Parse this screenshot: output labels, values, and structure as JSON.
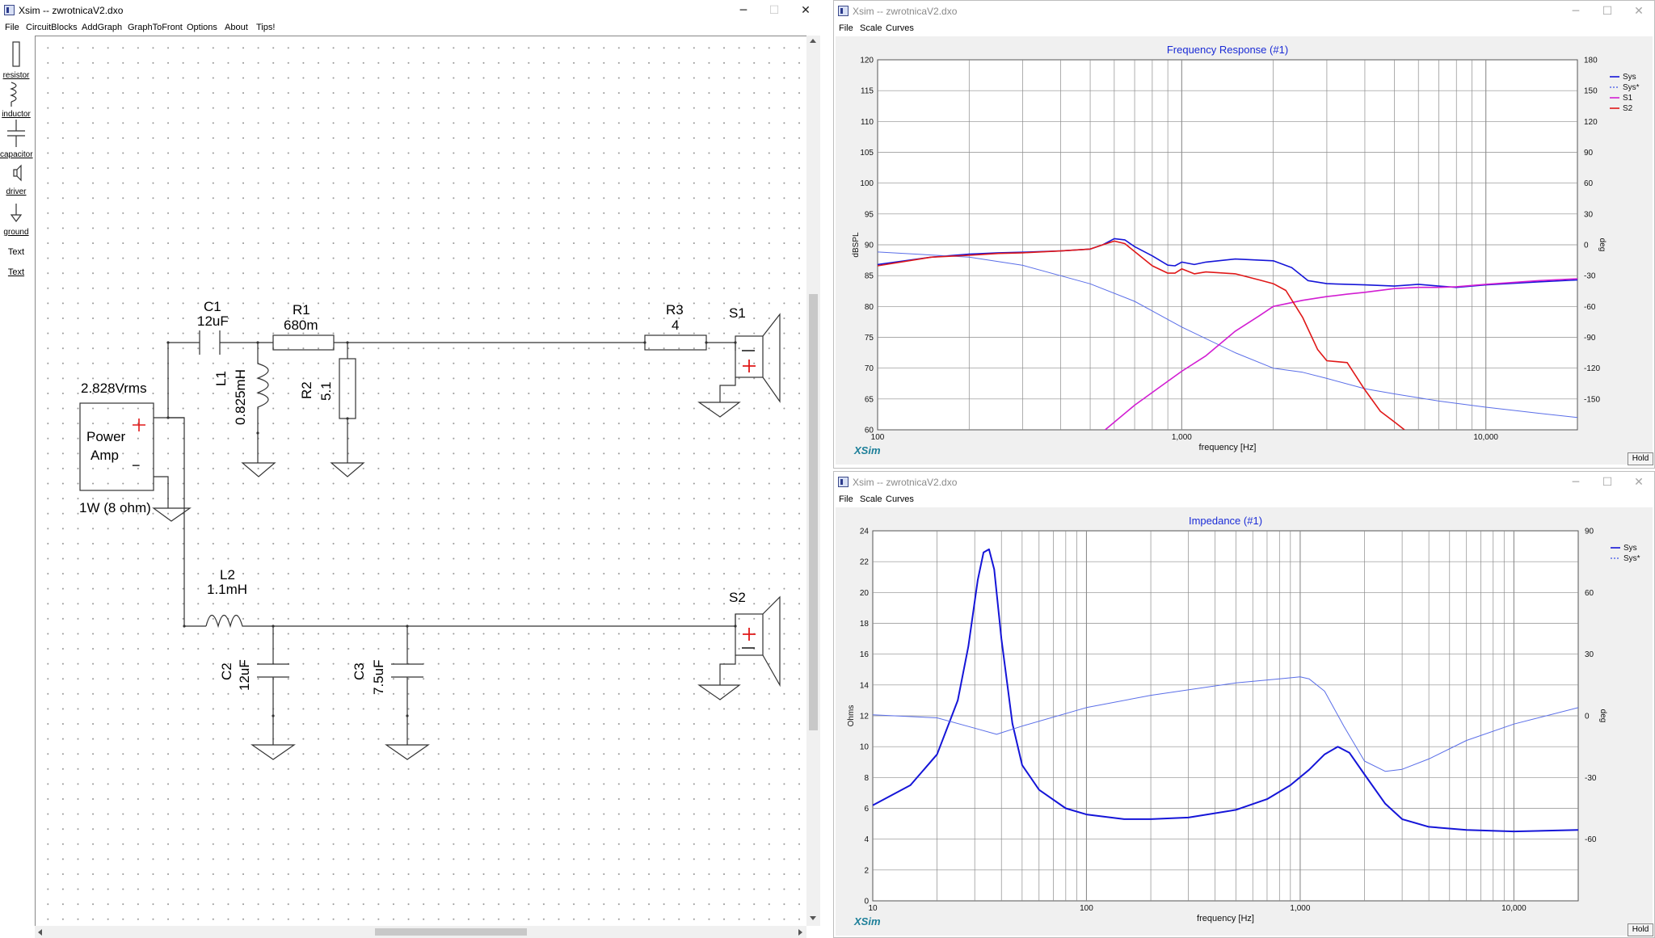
{
  "xsim_window": {
    "title": "Xsim -- zwrotnicaV2.dxo",
    "menu": [
      "File",
      "CircuitBlocks",
      "AddGraph",
      "GraphToFront",
      "Options",
      "About",
      "Tips!"
    ],
    "controls": {
      "minimize": "─",
      "maximize": "☐",
      "close": "✕"
    }
  },
  "toolbox": [
    {
      "icon": "resistor-icon",
      "label": "resistor"
    },
    {
      "icon": "inductor-icon",
      "label": "inductor"
    },
    {
      "icon": "capacitor-icon",
      "label": "capacitor"
    },
    {
      "icon": "driver-icon",
      "label": "driver"
    },
    {
      "icon": "ground-icon",
      "label": "ground"
    },
    {
      "icon": "",
      "label": "Text"
    },
    {
      "icon": "",
      "label": "Text"
    }
  ],
  "circuit": {
    "c1": {
      "name": "C1",
      "value": "12uF"
    },
    "r1": {
      "name": "R1",
      "value": "680m"
    },
    "r3": {
      "name": "R3",
      "value": "4"
    },
    "s1": {
      "name": "S1"
    },
    "l1": {
      "name": "L1",
      "value": "0.825mH"
    },
    "r2": {
      "name": "R2",
      "value": "5.1"
    },
    "source": {
      "voltage": "2.828Vrms",
      "line1": "Power",
      "line2": "Amp",
      "rating": "1W (8 ohm)",
      "plus": "+",
      "minus": "−"
    },
    "l2": {
      "name": "L2",
      "value": "1.1mH"
    },
    "s2": {
      "name": "S2"
    },
    "c2": {
      "name": "C2",
      "value": "12uF"
    },
    "c3": {
      "name": "C3",
      "value": "7.5uF"
    }
  },
  "freq_window": {
    "title": "Xsim -- zwrotnicaV2.dxo",
    "menu": [
      "File",
      "Scale",
      "Curves"
    ],
    "hold": "Hold",
    "logo": "XSim"
  },
  "imp_window": {
    "title": "Xsim -- zwrotnicaV2.dxo",
    "menu": [
      "File",
      "Scale",
      "Curves"
    ],
    "hold": "Hold",
    "logo": "XSim"
  },
  "chart_data": [
    {
      "type": "line",
      "title": "Frequency Response (#1)",
      "xlabel": "frequency [Hz]",
      "ylabel": "dBSPL",
      "y2label": "deg",
      "x_scale": "log",
      "xlim": [
        100,
        20000
      ],
      "ylim": [
        60,
        120
      ],
      "y2lim": [
        -180,
        180
      ],
      "x_ticks": [
        "100",
        "1,000",
        "10,000"
      ],
      "y_ticks": [
        "60",
        "65",
        "70",
        "75",
        "80",
        "85",
        "90",
        "95",
        "100",
        "105",
        "110",
        "115",
        "120"
      ],
      "y2_ticks": [
        "-150",
        "-120",
        "-90",
        "-60",
        "-30",
        "0",
        "30",
        "60",
        "90",
        "120",
        "150",
        "180"
      ],
      "grid": true,
      "legend": "top-right",
      "series": [
        {
          "name": "Sys",
          "color": "#1515d8",
          "width": 1.6,
          "axis": "left",
          "x": [
            100,
            150,
            200,
            250,
            300,
            400,
            500,
            550,
            600,
            650,
            700,
            800,
            900,
            950,
            1000,
            1100,
            1200,
            1500,
            2000,
            2300,
            2600,
            3000,
            4000,
            5000,
            6000,
            7000,
            8000,
            10000,
            15000,
            20000
          ],
          "y": [
            86.8,
            88.0,
            88.5,
            88.7,
            88.8,
            89.0,
            89.3,
            90.0,
            91.0,
            90.8,
            89.7,
            88.2,
            86.7,
            86.6,
            87.2,
            86.8,
            87.2,
            87.7,
            87.4,
            86.3,
            84.2,
            83.7,
            83.5,
            83.3,
            83.6,
            83.3,
            83.1,
            83.5,
            84.0,
            84.3
          ]
        },
        {
          "name": "Sys*",
          "color": "#5a6ee8",
          "width": 1,
          "axis": "right",
          "x": [
            100,
            200,
            300,
            500,
            700,
            1000,
            1500,
            2000,
            2500,
            3000,
            4000,
            5000,
            7000,
            10000,
            15000,
            20000
          ],
          "y": [
            -7,
            -12,
            -20,
            -38,
            -55,
            -80,
            -105,
            -120,
            -124,
            -130,
            -140,
            -145,
            -152,
            -158,
            -164,
            -168
          ]
        },
        {
          "name": "S1",
          "color": "#d21ed2",
          "width": 1.6,
          "axis": "left",
          "x": [
            560,
            700,
            850,
            1000,
            1200,
            1500,
            1800,
            2000,
            2500,
            3000,
            3500,
            4000,
            5000,
            6000,
            7000,
            8000,
            10000,
            15000,
            20000
          ],
          "y": [
            60.0,
            64.0,
            67.0,
            69.5,
            72.0,
            76.0,
            78.5,
            80.0,
            81.0,
            81.6,
            82.0,
            82.3,
            82.9,
            83.1,
            83.1,
            83.2,
            83.6,
            84.2,
            84.5
          ]
        },
        {
          "name": "S2",
          "color": "#e01818",
          "width": 1.6,
          "axis": "left",
          "x": [
            100,
            150,
            200,
            250,
            300,
            400,
            500,
            550,
            600,
            650,
            700,
            800,
            900,
            950,
            1000,
            1100,
            1200,
            1500,
            1800,
            2000,
            2200,
            2500,
            2800,
            3000,
            3500,
            4000,
            4500,
            5000,
            5400
          ],
          "y": [
            86.6,
            88.0,
            88.3,
            88.6,
            88.7,
            89.0,
            89.3,
            90.0,
            90.6,
            90.2,
            88.9,
            86.6,
            85.4,
            85.4,
            86.1,
            85.3,
            85.6,
            85.3,
            84.3,
            83.7,
            82.6,
            78.2,
            73.0,
            71.2,
            70.9,
            66.5,
            63.0,
            61.3,
            60.0
          ]
        }
      ]
    },
    {
      "type": "line",
      "title": "Impedance (#1)",
      "xlabel": "frequency [Hz]",
      "ylabel": "Ohms",
      "y2label": "deg",
      "x_scale": "log",
      "xlim": [
        10,
        20000
      ],
      "ylim": [
        0,
        24
      ],
      "y2lim": [
        -90,
        90
      ],
      "x_ticks": [
        "10",
        "100",
        "1,000",
        "10,000"
      ],
      "y_ticks": [
        "0",
        "2",
        "4",
        "6",
        "8",
        "10",
        "12",
        "14",
        "16",
        "18",
        "20",
        "22",
        "24"
      ],
      "y2_ticks": [
        "-60",
        "-30",
        "0",
        "30",
        "60",
        "90"
      ],
      "grid": true,
      "legend": "top-right",
      "series": [
        {
          "name": "Sys",
          "color": "#1515d8",
          "width": 2,
          "axis": "left",
          "x": [
            10,
            15,
            20,
            25,
            28,
            31,
            33,
            35,
            37,
            40,
            45,
            50,
            60,
            80,
            100,
            150,
            200,
            300,
            500,
            700,
            900,
            1100,
            1300,
            1500,
            1700,
            2000,
            2500,
            3000,
            4000,
            6000,
            10000,
            20000
          ],
          "y": [
            6.2,
            7.5,
            9.5,
            13.0,
            16.5,
            20.8,
            22.6,
            22.8,
            21.5,
            17.0,
            11.5,
            8.8,
            7.2,
            6.0,
            5.6,
            5.3,
            5.3,
            5.4,
            5.9,
            6.6,
            7.5,
            8.5,
            9.5,
            10.0,
            9.6,
            8.2,
            6.3,
            5.3,
            4.8,
            4.6,
            4.5,
            4.6
          ]
        },
        {
          "name": "Sys*",
          "color": "#5a6ee8",
          "width": 1,
          "axis": "right",
          "x": [
            10,
            20,
            30,
            38,
            50,
            100,
            200,
            500,
            800,
            1000,
            1100,
            1300,
            1600,
            2000,
            2500,
            3000,
            4000,
            6000,
            10000,
            20000
          ],
          "y": [
            0.5,
            -1,
            -6,
            -9,
            -5,
            4,
            10,
            16,
            18,
            19,
            18,
            12,
            -5,
            -22,
            -27,
            -26,
            -21,
            -12,
            -4,
            4
          ]
        }
      ]
    }
  ]
}
